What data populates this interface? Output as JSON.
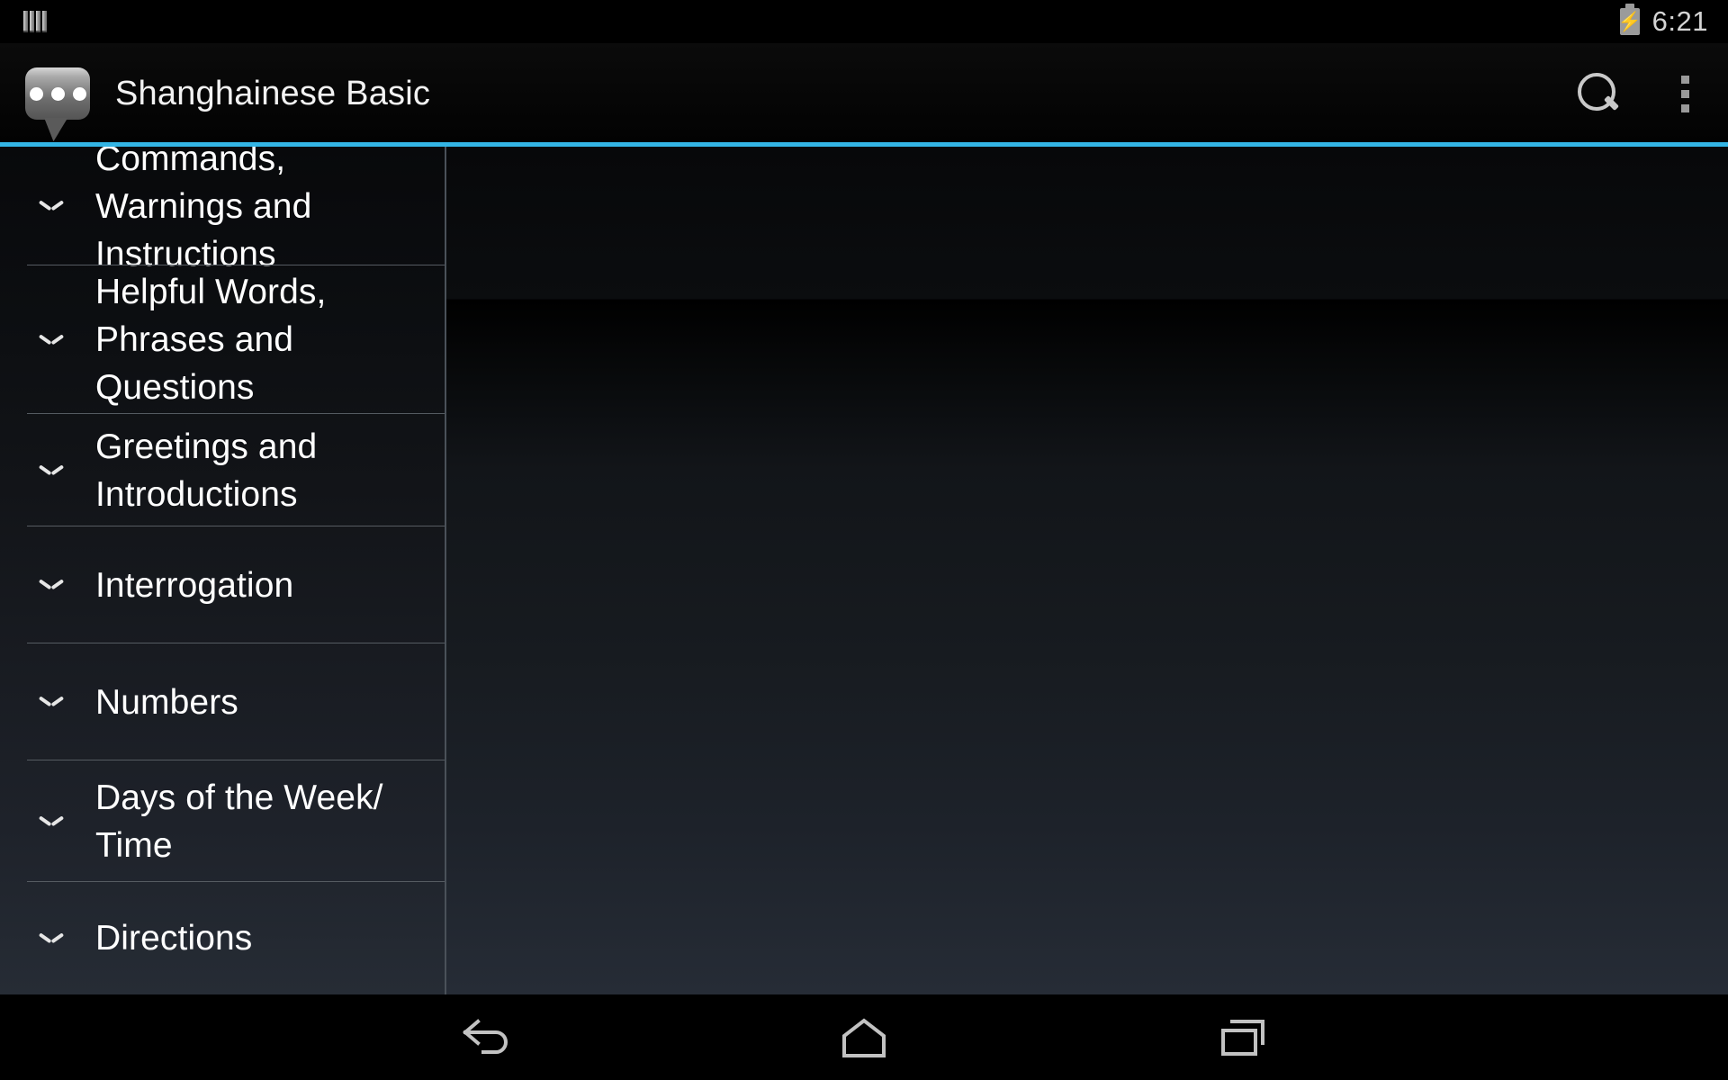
{
  "status_bar": {
    "left_icon": "signal-bars-icon",
    "battery_icon": "battery-charging-icon",
    "time": "6:21"
  },
  "action_bar": {
    "app_icon": "speech-bubble-icon",
    "title": "Shanghainese Basic",
    "search_icon": "search-icon",
    "overflow_icon": "overflow-menu-icon",
    "accent_color": "#33b5e5"
  },
  "list_pane": {
    "expander_icon": "chevron-down-icon",
    "items": [
      {
        "label": "Commands,\nWarnings and\nInstructions"
      },
      {
        "label": "Helpful Words,\nPhrases and\nQuestions"
      },
      {
        "label": "Greetings and\nIntroductions"
      },
      {
        "label": "Interrogation"
      },
      {
        "label": "Numbers"
      },
      {
        "label": "Days of the Week/\nTime"
      },
      {
        "label": "Directions"
      }
    ]
  },
  "detail_pane": {
    "content": ""
  },
  "nav_bar": {
    "back_icon": "back-arrow-icon",
    "home_icon": "home-icon",
    "recents_icon": "recent-apps-icon"
  }
}
